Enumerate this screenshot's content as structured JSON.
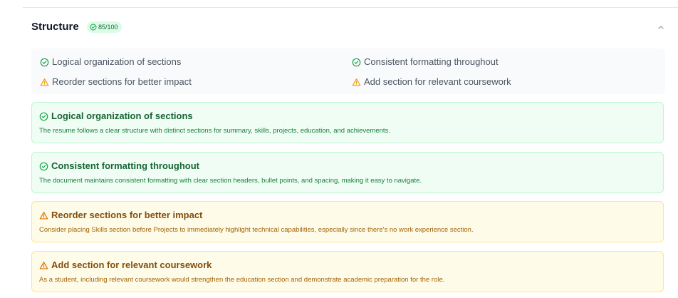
{
  "section": {
    "title": "Structure",
    "score": "85/100",
    "collapse_icon": "chevron-up-icon"
  },
  "summary": {
    "strengths": [
      {
        "label": "Logical organization of sections",
        "icon": "check-circle-icon"
      },
      {
        "label": "Consistent formatting throughout",
        "icon": "check-circle-icon"
      }
    ],
    "improvements": [
      {
        "label": "Reorder sections for better impact",
        "icon": "warning-triangle-icon"
      },
      {
        "label": "Add section for relevant coursework",
        "icon": "warning-triangle-icon"
      }
    ]
  },
  "cards": [
    {
      "status": "strength",
      "icon": "check-circle-icon",
      "title": "Logical organization of sections",
      "description": "The resume follows a clear structure with distinct sections for summary, skills, projects, education, and achievements."
    },
    {
      "status": "strength",
      "icon": "check-circle-icon",
      "title": "Consistent formatting throughout",
      "description": "The document maintains consistent formatting with clear section headers, bullet points, and spacing, making it easy to navigate."
    },
    {
      "status": "improvement",
      "icon": "warning-triangle-icon",
      "title": "Reorder sections for better impact",
      "description": "Consider placing Skills section before Projects to immediately highlight technical capabilities, especially since there's no work experience section."
    },
    {
      "status": "improvement",
      "icon": "warning-triangle-icon",
      "title": "Add section for relevant coursework",
      "description": "As a student, including relevant coursework would strengthen the education section and demonstrate academic preparation for the role."
    }
  ],
  "colors": {
    "strength": "#16a34a",
    "improvement": "#f59e0b",
    "badge_bg": "#dcfce7"
  }
}
